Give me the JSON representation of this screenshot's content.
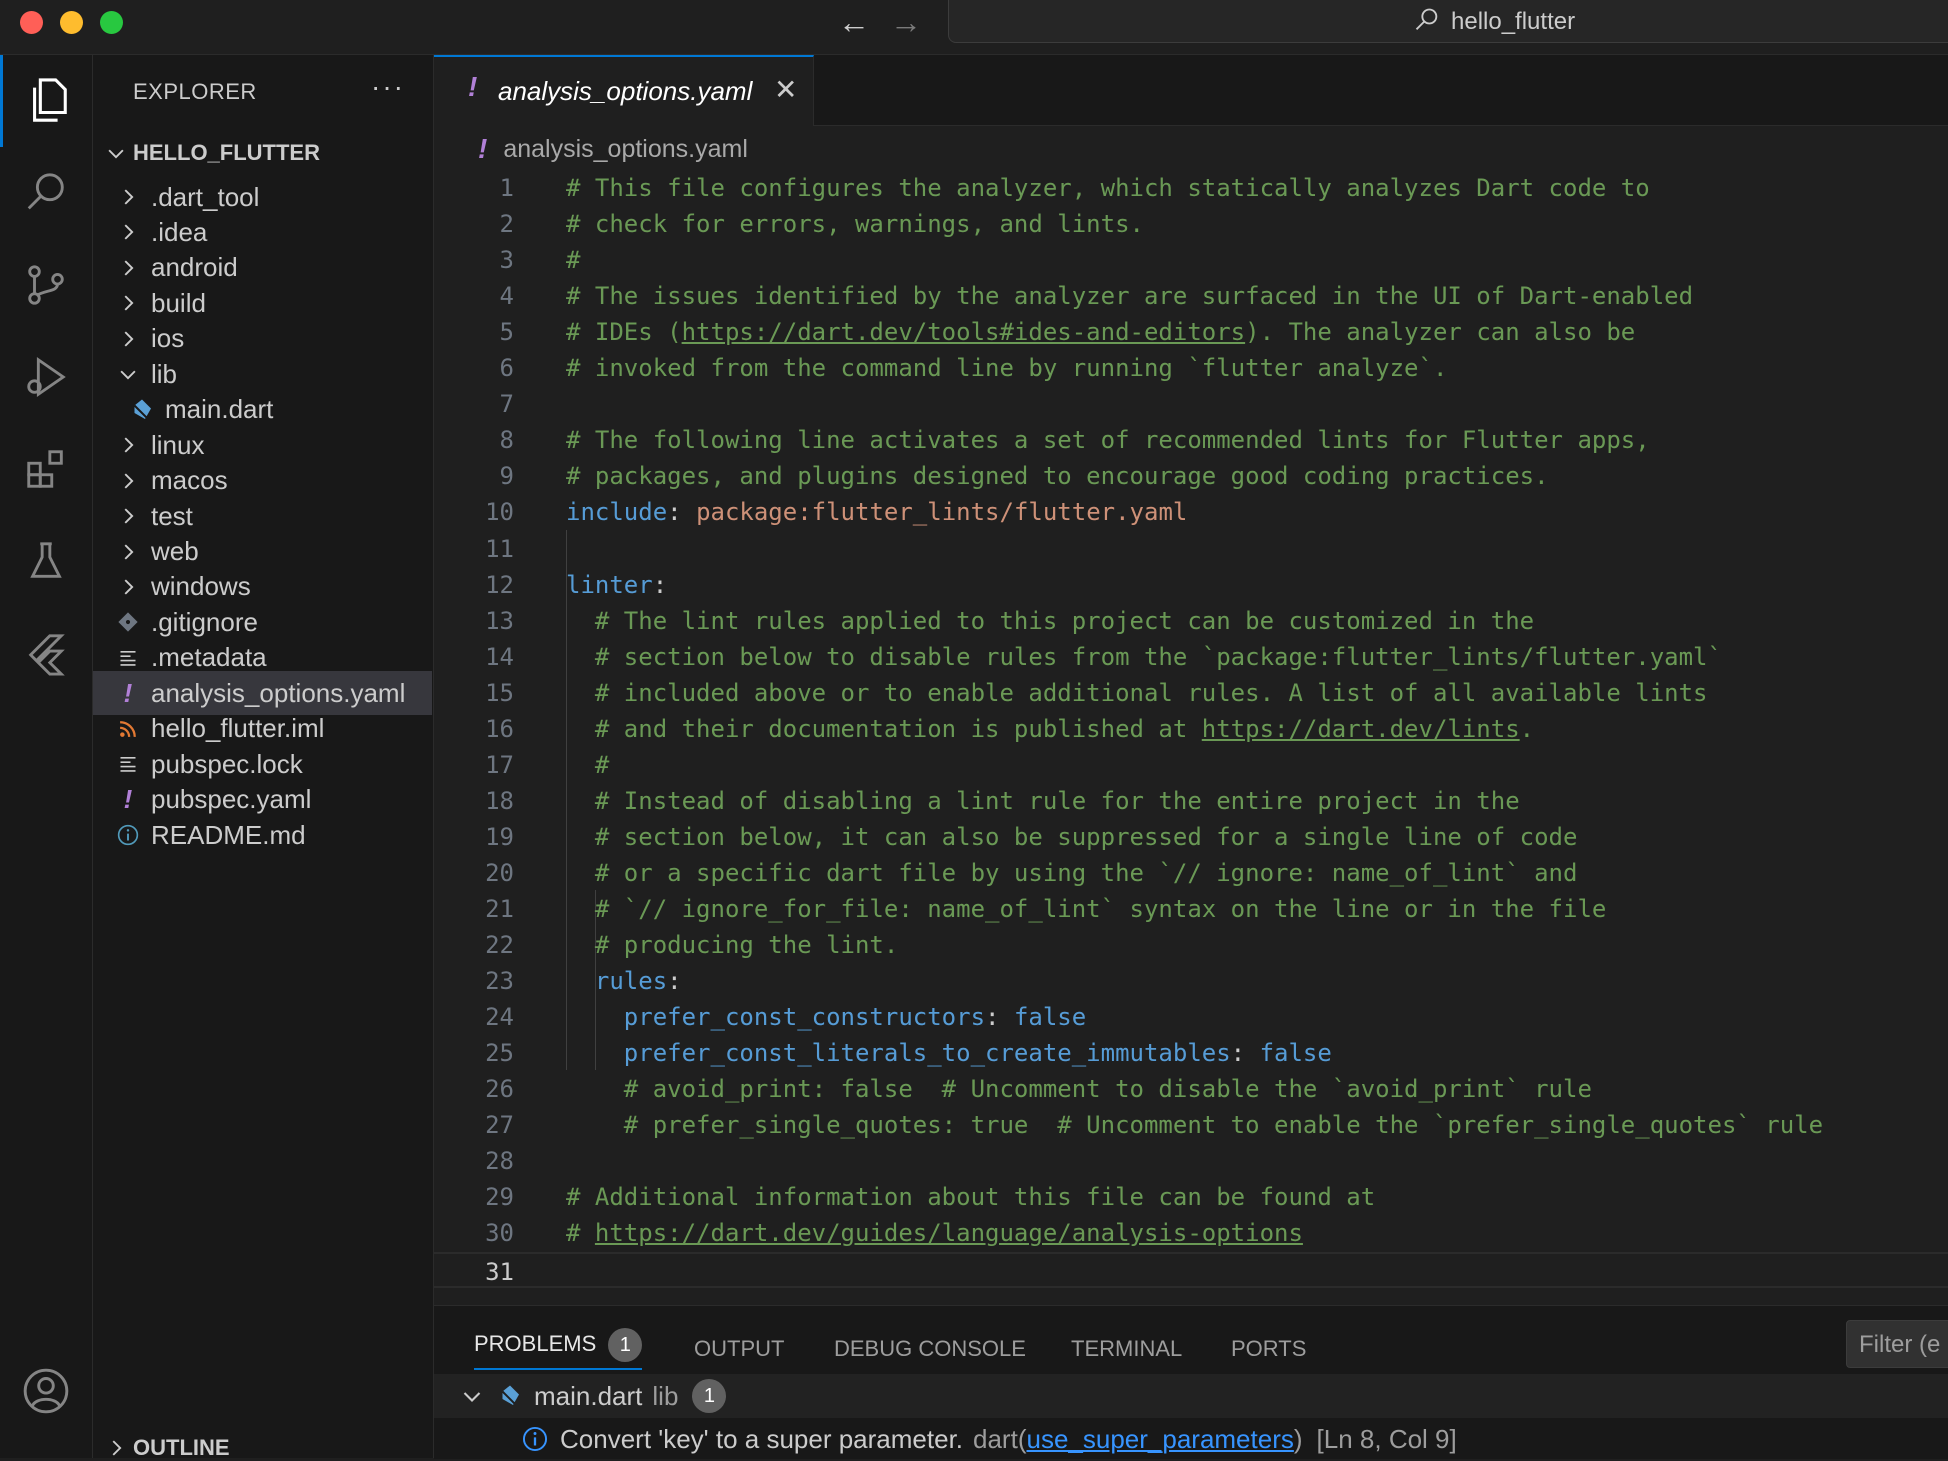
{
  "titlebar": {
    "search_text": "hello_flutter"
  },
  "explorer": {
    "title": "EXPLORER",
    "more": "···",
    "root": "HELLO_FLUTTER",
    "items": [
      {
        "label": ".dart_tool",
        "icon": "chevron-right-icon"
      },
      {
        "label": ".idea",
        "icon": "chevron-right-icon"
      },
      {
        "label": "android",
        "icon": "chevron-right-icon"
      },
      {
        "label": "build",
        "icon": "chevron-right-icon"
      },
      {
        "label": "ios",
        "icon": "chevron-right-icon"
      },
      {
        "label": "lib",
        "icon": "chevron-down-icon"
      },
      {
        "label": "main.dart",
        "icon": "dart-file-icon"
      },
      {
        "label": "linux",
        "icon": "chevron-right-icon"
      },
      {
        "label": "macos",
        "icon": "chevron-right-icon"
      },
      {
        "label": "test",
        "icon": "chevron-right-icon"
      },
      {
        "label": "web",
        "icon": "chevron-right-icon"
      },
      {
        "label": "windows",
        "icon": "chevron-right-icon"
      },
      {
        "label": ".gitignore",
        "icon": "git-file-icon"
      },
      {
        "label": ".metadata",
        "icon": "lines-file-icon"
      },
      {
        "label": "analysis_options.yaml",
        "icon": "yaml-file-icon",
        "selected": true
      },
      {
        "label": "hello_flutter.iml",
        "icon": "rss-file-icon"
      },
      {
        "label": "pubspec.lock",
        "icon": "lines-file-icon"
      },
      {
        "label": "pubspec.yaml",
        "icon": "yaml-file-icon"
      },
      {
        "label": "README.md",
        "icon": "info-file-icon"
      }
    ],
    "outline": "OUTLINE"
  },
  "editor": {
    "tab_bang": "!",
    "tab_label": "analysis_options.yaml",
    "tab_close": "✕",
    "breadcrumb_bang": "!",
    "breadcrumb": "analysis_options.yaml",
    "current_line": 31,
    "lines": [
      [
        {
          "t": "# This file configures the analyzer, which statically analyzes Dart code to",
          "c": "com"
        }
      ],
      [
        {
          "t": "# check for errors, warnings, and lints.",
          "c": "com"
        }
      ],
      [
        {
          "t": "#",
          "c": "com"
        }
      ],
      [
        {
          "t": "# The issues identified by the analyzer are surfaced in the UI of Dart-enabled",
          "c": "com"
        }
      ],
      [
        {
          "t": "# IDEs (",
          "c": "com"
        },
        {
          "t": "https://dart.dev/tools#ides-and-editors",
          "c": "com link"
        },
        {
          "t": "). The analyzer can also be",
          "c": "com"
        }
      ],
      [
        {
          "t": "# invoked from the command line by running `flutter analyze`.",
          "c": "com"
        }
      ],
      [],
      [
        {
          "t": "# The following line activates a set of recommended lints for Flutter apps,",
          "c": "com"
        }
      ],
      [
        {
          "t": "# packages, and plugins designed to encourage good coding practices.",
          "c": "com"
        }
      ],
      [
        {
          "t": "include",
          "c": "key"
        },
        {
          "t": ": ",
          "c": "pun"
        },
        {
          "t": "package:flutter_lints/flutter.yaml",
          "c": "str"
        }
      ],
      [],
      [
        {
          "t": "linter",
          "c": "key"
        },
        {
          "t": ":",
          "c": "pun"
        }
      ],
      [
        {
          "t": "  # The lint rules applied to this project can be customized in the",
          "c": "com"
        }
      ],
      [
        {
          "t": "  # section below to disable rules from the `package:flutter_lints/flutter.yaml`",
          "c": "com"
        }
      ],
      [
        {
          "t": "  # included above or to enable additional rules. A list of all available lints",
          "c": "com"
        }
      ],
      [
        {
          "t": "  # and their documentation is published at ",
          "c": "com"
        },
        {
          "t": "https://dart.dev/lints",
          "c": "com link"
        },
        {
          "t": ".",
          "c": "com"
        }
      ],
      [
        {
          "t": "  #",
          "c": "com"
        }
      ],
      [
        {
          "t": "  # Instead of disabling a lint rule for the entire project in the",
          "c": "com"
        }
      ],
      [
        {
          "t": "  # section below, it can also be suppressed for a single line of code",
          "c": "com"
        }
      ],
      [
        {
          "t": "  # or a specific dart file by using the `// ignore: name_of_lint` and",
          "c": "com"
        }
      ],
      [
        {
          "t": "  # `// ignore_for_file: name_of_lint` syntax on the line or in the file",
          "c": "com"
        }
      ],
      [
        {
          "t": "  # producing the lint.",
          "c": "com"
        }
      ],
      [
        {
          "t": "  ",
          "c": "pun"
        },
        {
          "t": "rules",
          "c": "key"
        },
        {
          "t": ":",
          "c": "pun"
        }
      ],
      [
        {
          "t": "    ",
          "c": "pun"
        },
        {
          "t": "prefer_const_constructors",
          "c": "key"
        },
        {
          "t": ": ",
          "c": "pun"
        },
        {
          "t": "false",
          "c": "key"
        }
      ],
      [
        {
          "t": "    ",
          "c": "pun"
        },
        {
          "t": "prefer_const_literals_to_create_immutables",
          "c": "key"
        },
        {
          "t": ": ",
          "c": "pun"
        },
        {
          "t": "false",
          "c": "key"
        }
      ],
      [
        {
          "t": "    # avoid_print: false  # Uncomment to disable the `avoid_print` rule",
          "c": "com"
        }
      ],
      [
        {
          "t": "    # prefer_single_quotes: true  # Uncomment to enable the `prefer_single_quotes` rule",
          "c": "com"
        }
      ],
      [],
      [
        {
          "t": "# Additional information about this file can be found at",
          "c": "com"
        }
      ],
      [
        {
          "t": "# ",
          "c": "com"
        },
        {
          "t": "https://dart.dev/guides/language/analysis-options",
          "c": "com link"
        }
      ],
      []
    ]
  },
  "panel": {
    "tabs": [
      "PROBLEMS",
      "OUTPUT",
      "DEBUG CONSOLE",
      "TERMINAL",
      "PORTS"
    ],
    "problems_count": "1",
    "filter_placeholder": "Filter (e",
    "group_file": "main.dart",
    "group_dir": "lib",
    "group_count": "1",
    "problem_message": "Convert 'key' to a super parameter.",
    "problem_source": "dart(",
    "problem_code": "use_super_parameters",
    "problem_source_end": ")",
    "problem_location": "[Ln 8, Col 9]"
  },
  "colors": {
    "accent": "#0078d4",
    "comment": "#6a9955",
    "key": "#569cd6",
    "string": "#ce9178",
    "yaml": "#b180d7"
  }
}
